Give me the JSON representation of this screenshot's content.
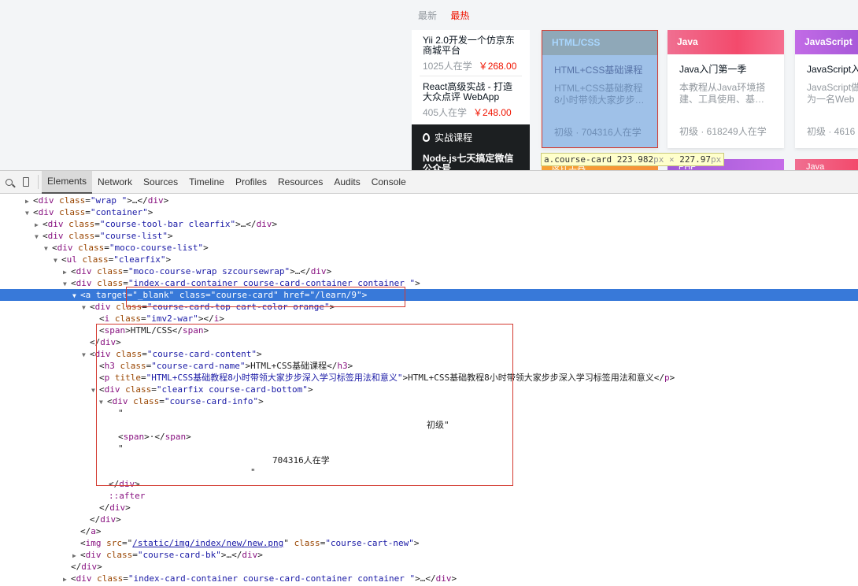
{
  "page": {
    "sort_tabs": [
      {
        "label": "最新",
        "active": false
      },
      {
        "label": "最热",
        "active": true
      }
    ],
    "side_list": {
      "items": [
        {
          "title": "Yii 2.0开发一个仿京东商城平台",
          "students": "1025人在学",
          "price": "￥268.00"
        },
        {
          "title": "React高级实战 - 打造大众点评 WebApp",
          "students": "405人在学",
          "price": "￥248.00"
        }
      ],
      "dark": {
        "header": "实战课程",
        "title": "Node.js七天搞定微信公众号"
      }
    },
    "cards": [
      {
        "tag": "HTML/CSS",
        "name": "HTML+CSS基础课程",
        "desc": "HTML+CSS基础教程8小时带领大家步步…",
        "info": "初级 · 704316人在学",
        "highlighted": true
      },
      {
        "tag": "Java",
        "name": "Java入门第一季",
        "desc": "本教程从Java环境搭建、工具使用、基…",
        "info": "初级 · 618249人在学",
        "highlighted": false
      },
      {
        "tag": "JavaScript",
        "name": "JavaScript入",
        "desc": "JavaScript做为一名Web工程师的",
        "info": "初级 · 4616",
        "highlighted": false
      }
    ],
    "row2_tags": [
      "设计工具",
      "PHP",
      "Java"
    ],
    "tooltip": {
      "selector": "a.course-card",
      "size": "223.982",
      "unit1": "px",
      "times": "×",
      "size2": "227.97",
      "unit2": "px"
    }
  },
  "devtools": {
    "tabs": [
      {
        "label": "Elements",
        "active": true
      },
      {
        "label": "Network",
        "active": false
      },
      {
        "label": "Sources",
        "active": false
      },
      {
        "label": "Timeline",
        "active": false
      },
      {
        "label": "Profiles",
        "active": false
      },
      {
        "label": "Resources",
        "active": false
      },
      {
        "label": "Audits",
        "active": false
      },
      {
        "label": "Console",
        "active": false
      }
    ],
    "text": {
      "r0_t": "div",
      "r0_a": "class",
      "r0_v": "\"wrap \"",
      "r0_e": ">…</",
      "r0_c": "div",
      "r1_t": "div",
      "r1_a": "class",
      "r1_v": "\"container\"",
      "r2_t": "div",
      "r2_a": "class",
      "r2_v": "\"course-tool-bar clearfix\"",
      "r2_e": ">…</",
      "r2_c": "div",
      "r3_t": "div",
      "r3_a": "class",
      "r3_v": "\"course-list\"",
      "r4_t": "div",
      "r4_a": "class",
      "r4_v": "\"moco-course-list\"",
      "r5_t": "ul",
      "r5_a": "class",
      "r5_v": "\"clearfix\"",
      "r6_t": "div",
      "r6_a": "class",
      "r6_v": "\"moco-course-wrap szcoursewrap\"",
      "r6_e": ">…</",
      "r6_c": "div",
      "r7_t": "div",
      "r7_a": "class",
      "r7_v": "\"index-card-container course-card-container container \"",
      "r8_t": "a",
      "r8_a1": "target",
      "r8_v1": "\"_blank\"",
      "r8_a2": "class",
      "r8_v2": "\"course-card\"",
      "r8_a3": "href",
      "r8_v3": "\"/learn/9\"",
      "r9_t": "div",
      "r9_a": "class",
      "r9_v": "\"course-card-top cart-color orange\"",
      "r10_t": "i",
      "r10_a": "class",
      "r10_v": "\"imv2-war\"",
      "r10_c": "i",
      "r11_t": "span",
      "r11_x": "HTML/CSS",
      "r11_c": "span",
      "r12_c": "div",
      "r13_t": "div",
      "r13_a": "class",
      "r13_v": "\"course-card-content\"",
      "r14_t": "h3",
      "r14_a": "class",
      "r14_v": "\"course-card-name\"",
      "r14_x": "HTML+CSS基础课程",
      "r14_c": "h3",
      "r15_t": "p",
      "r15_a": "title",
      "r15_v": "\"HTML+CSS基础教程8小时带领大家步步深入学习标签用法和意义\"",
      "r15_x": "HTML+CSS基础教程8小时带领大家步步深入学习标签用法和意义",
      "r15_c": "p",
      "r16_t": "div",
      "r16_a": "class",
      "r16_v": "\"clearfix course-card-bottom\"",
      "r17_t": "div",
      "r17_a": "class",
      "r17_v": "\"course-card-info\"",
      "r18_x": "\"",
      "r19_x": "初级\"",
      "r20_t": "span",
      "r20_x": "·",
      "r20_c": "span",
      "r21_x": "\"",
      "r22_x": "704316人在学",
      "r23_x": "\"",
      "r24_c": "div",
      "r25_x": "::after",
      "r26_c": "div",
      "r27_c": "div",
      "r28_c": "a",
      "r29_t": "img",
      "r29_a1": "src",
      "r29_v1": "/static/img/index/new/new.png",
      "r29_a2": "class",
      "r29_v2": "\"course-cart-new\"",
      "r30_t": "div",
      "r30_a": "class",
      "r30_v": "\"course-card-bk\"",
      "r30_e": ">…</",
      "r30_c": "div",
      "r31_c": "div",
      "r32_t": "div",
      "r32_a": "class",
      "r32_v": "\"index-card-container course-card-container container \"",
      "r32_e": ">…</",
      "r32_c": "div"
    }
  }
}
